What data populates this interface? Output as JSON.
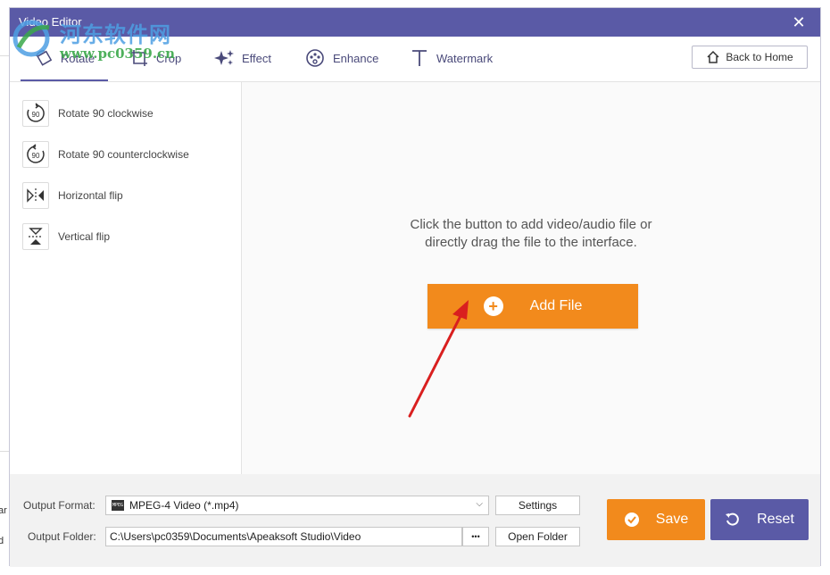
{
  "window": {
    "title": "Video Editor"
  },
  "watermark": {
    "cn": "河东软件网",
    "url": "www.pc0359.cn"
  },
  "tabs": [
    {
      "label": "Rotate",
      "icon": "rotate-icon",
      "active": true
    },
    {
      "label": "Crop",
      "icon": "crop-icon",
      "active": false
    },
    {
      "label": "Effect",
      "icon": "effect-icon",
      "active": false
    },
    {
      "label": "Enhance",
      "icon": "enhance-icon",
      "active": false
    },
    {
      "label": "Watermark",
      "icon": "watermark-icon",
      "active": false
    }
  ],
  "back_home": {
    "label": "Back to Home"
  },
  "rotate_options": [
    {
      "label": "Rotate 90 clockwise",
      "icon_text": "90"
    },
    {
      "label": "Rotate 90 counterclockwise",
      "icon_text": "90"
    },
    {
      "label": "Horizontal flip"
    },
    {
      "label": "Vertical flip"
    }
  ],
  "drop_area": {
    "hint_line1": "Click the button to add video/audio file or",
    "hint_line2": "directly drag the file to the interface.",
    "add_file_label": "Add File"
  },
  "output": {
    "format_label": "Output Format:",
    "format_value": "MPEG-4 Video (*.mp4)",
    "format_icon_text": "MPEG",
    "settings_label": "Settings",
    "folder_label": "Output Folder:",
    "folder_value": "C:\\Users\\pc0359\\Documents\\Apeaksoft Studio\\Video",
    "browse_label": "•••",
    "open_folder_label": "Open Folder"
  },
  "actions": {
    "save_label": "Save",
    "reset_label": "Reset"
  },
  "background": {
    "side_text_1": "ar",
    "side_text_2": "d"
  },
  "colors": {
    "accent": "#5a5aa6",
    "orange": "#f28a1c",
    "arrow": "#d91f1f"
  }
}
